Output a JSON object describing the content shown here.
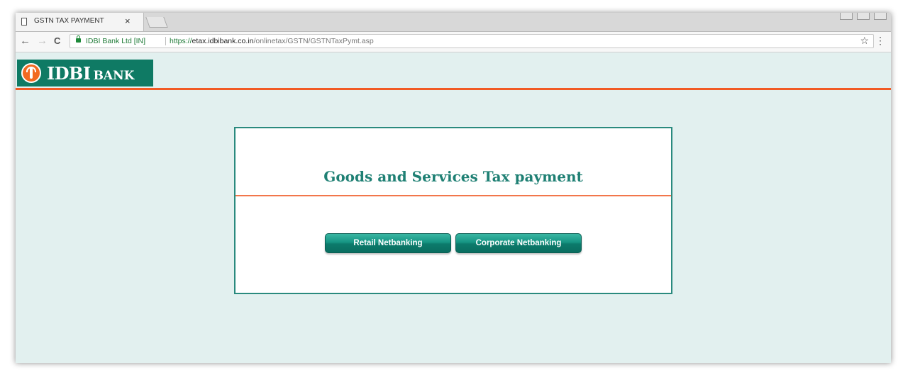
{
  "browser": {
    "tab_title": "GSTN TAX PAYMENT",
    "tab_close": "×",
    "back": "←",
    "forward": "→",
    "reload": "C",
    "cert_label": "IDBI Bank Ltd [IN]",
    "url_scheme": "https://",
    "url_host": "etax.idbibank.co.in",
    "url_path": "/onlinetax/GSTN/GSTNTaxPymt.asp",
    "bookmark_star": "☆",
    "menu": "⋮"
  },
  "header": {
    "logo_idbi": "IDBI",
    "logo_bank": "BANK",
    "brand_color": "#0f7a64",
    "accent_color": "#f15a24"
  },
  "panel": {
    "title": "Goods and Services Tax payment",
    "buttons": [
      {
        "label": "Retail Netbanking"
      },
      {
        "label": "Corporate Netbanking"
      }
    ]
  }
}
